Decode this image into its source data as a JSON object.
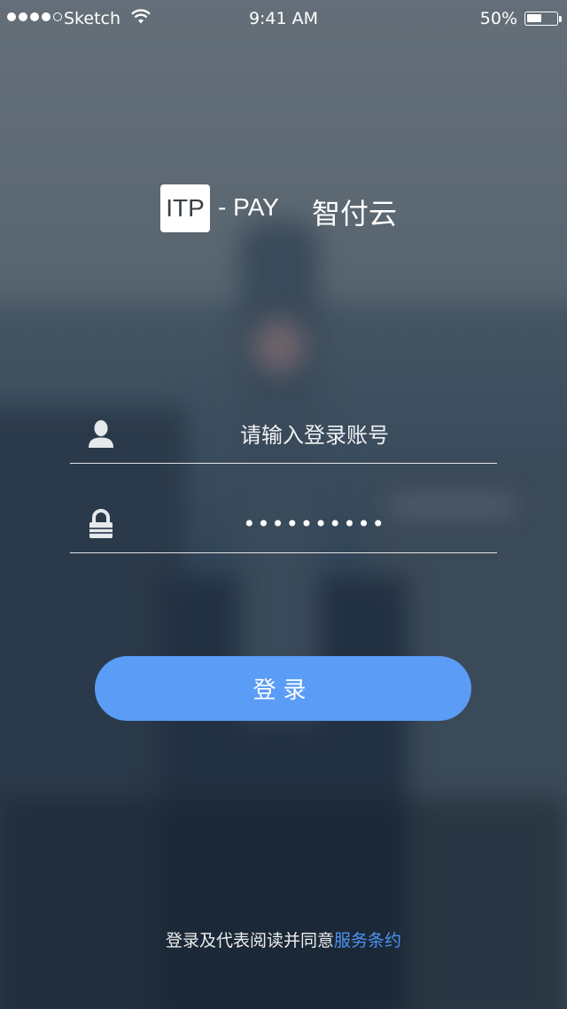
{
  "status_bar": {
    "carrier": "Sketch",
    "time": "9:41 AM",
    "battery": "50%"
  },
  "logo": {
    "box_text": "ITP",
    "pay_text": "- PAY",
    "chinese_name": "智付云"
  },
  "login_form": {
    "account_placeholder": "请输入登录账号",
    "password_value": "••••••••••"
  },
  "login_button": {
    "label": "登录"
  },
  "footer": {
    "agreement_text": "登录及代表阅读并同意",
    "terms_link": "服务条约"
  },
  "colors": {
    "button_blue": "#5b9cf6",
    "link_blue": "#4d93f0"
  },
  "icons": {
    "user": "user-icon",
    "lock": "lock-icon",
    "wifi": "wifi-icon",
    "battery": "battery-icon"
  }
}
